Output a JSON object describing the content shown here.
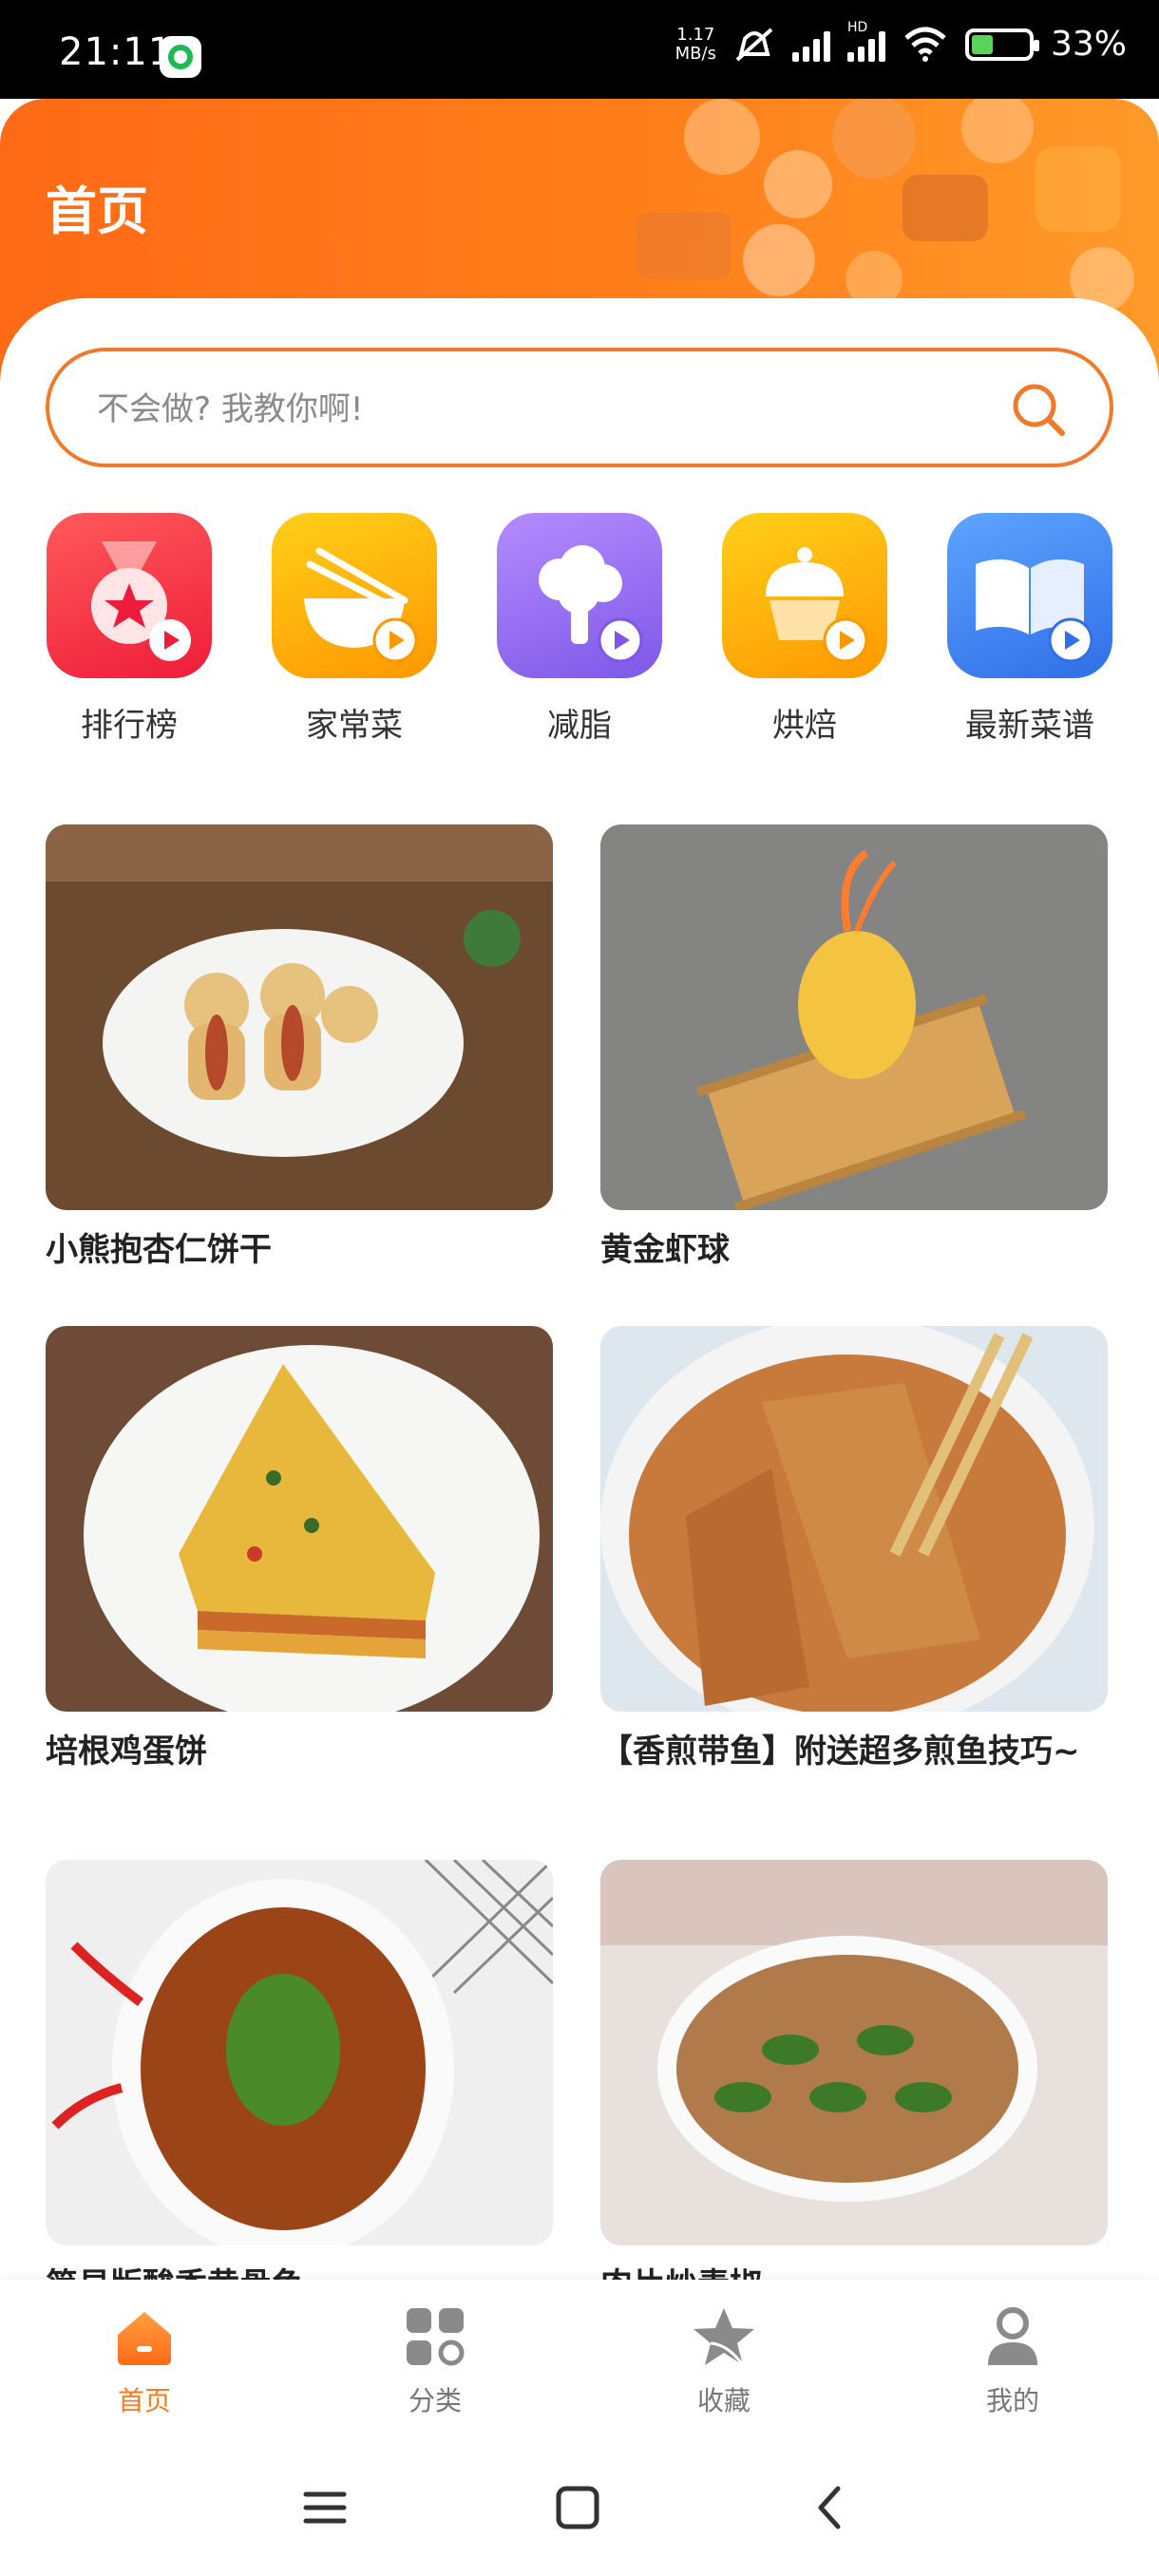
{
  "status_bar": {
    "time": "21:11",
    "speed_value": "1.17",
    "speed_unit": "MB/s",
    "network": "HD",
    "battery": "33%"
  },
  "header": {
    "title": "首页"
  },
  "search": {
    "placeholder": "不会做? 我教你啊!"
  },
  "categories": [
    {
      "label": "排行榜",
      "icon": "ranking-medal-icon",
      "color": "#f5233a"
    },
    {
      "label": "家常菜",
      "icon": "home-cooking-bowl-icon",
      "color": "#ffb300"
    },
    {
      "label": "减脂",
      "icon": "fat-loss-broccoli-icon",
      "color": "#9b6cf0"
    },
    {
      "label": "烘焙",
      "icon": "baking-cupcake-icon",
      "color": "#ffb300"
    },
    {
      "label": "最新菜谱",
      "icon": "new-recipe-book-icon",
      "color": "#3e86f5"
    }
  ],
  "recipes": [
    {
      "title": "小熊抱杏仁饼干"
    },
    {
      "title": "黄金虾球"
    },
    {
      "title": "培根鸡蛋饼"
    },
    {
      "title": "【香煎带鱼】附送超多煎鱼技巧~"
    },
    {
      "title": "简易版酸香黄骨鱼"
    },
    {
      "title": "肉片炒青椒"
    }
  ],
  "bottom_nav": [
    {
      "label": "首页",
      "icon": "home-icon",
      "active": true
    },
    {
      "label": "分类",
      "icon": "category-grid-icon",
      "active": false
    },
    {
      "label": "收藏",
      "icon": "favorite-star-icon",
      "active": false
    },
    {
      "label": "我的",
      "icon": "profile-icon",
      "active": false
    }
  ],
  "colors": {
    "accent": "#ff7a1e",
    "header_start": "#ff6a16",
    "header_end": "#ff9a2a",
    "search_border": "#f07a2a"
  }
}
